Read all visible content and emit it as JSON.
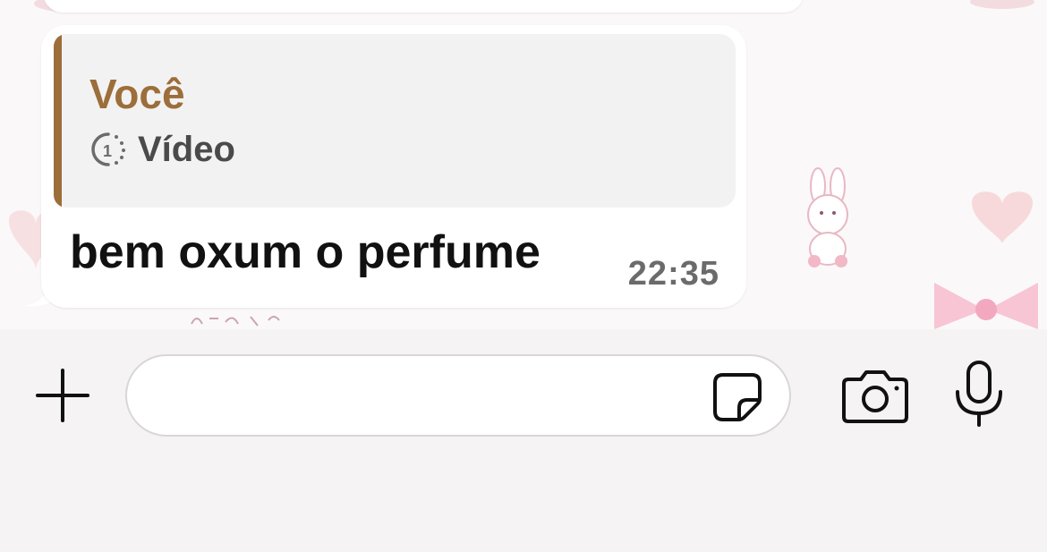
{
  "message": {
    "quote": {
      "author": "Você",
      "media_icon": "timer-icon",
      "media_label": "Vídeo"
    },
    "text": "bem oxum o perfume",
    "time": "22:35"
  },
  "input_bar": {
    "placeholder": "",
    "icons": [
      "plus-icon",
      "sticker-icon",
      "camera-icon",
      "microphone-icon"
    ]
  },
  "colors": {
    "quote_accent": "#9c6e3a",
    "bubble": "#ffffff",
    "background": "#fbf8f9"
  }
}
